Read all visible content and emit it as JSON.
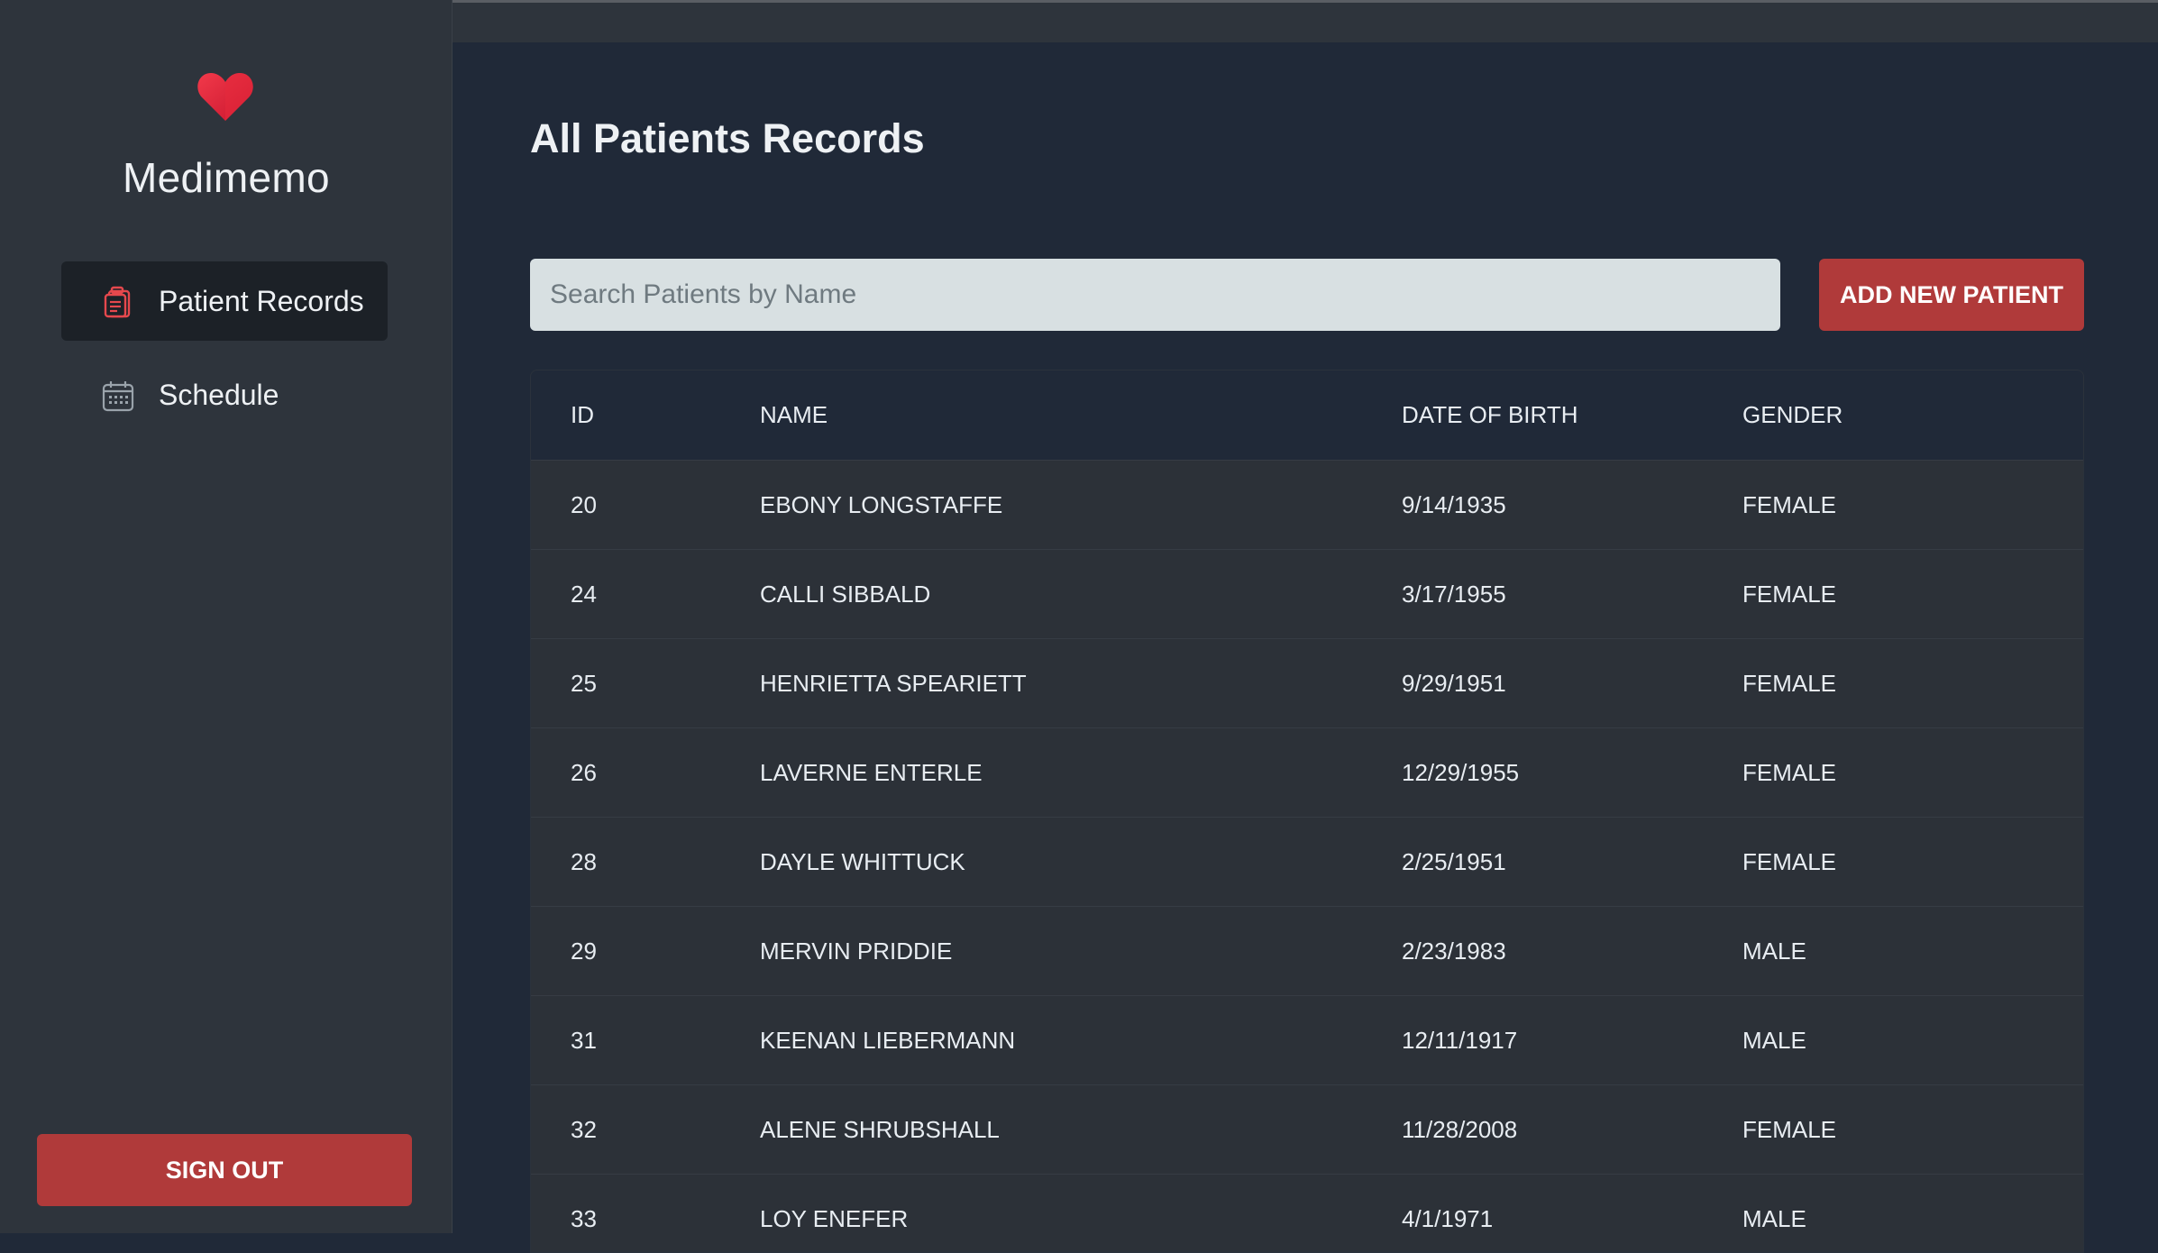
{
  "app": {
    "brand": "Medimemo",
    "accent_color": "#b03a3a",
    "icon_logo": "heart-icon"
  },
  "sidebar": {
    "items": [
      {
        "label": "Patient Records",
        "icon": "clipboard-icon",
        "active": true
      },
      {
        "label": "Schedule",
        "icon": "calendar-icon",
        "active": false
      }
    ],
    "sign_out_label": "SIGN OUT"
  },
  "main": {
    "title": "All Patients Records",
    "search": {
      "placeholder": "Search Patients by Name",
      "value": ""
    },
    "add_button_label": "ADD NEW PATIENT",
    "table": {
      "headers": {
        "id": "ID",
        "name": "NAME",
        "dob": "DATE OF BIRTH",
        "gender": "GENDER"
      },
      "rows": [
        {
          "id": "20",
          "name": "EBONY LONGSTAFFE",
          "dob": "9/14/1935",
          "gender": "FEMALE"
        },
        {
          "id": "24",
          "name": "CALLI SIBBALD",
          "dob": "3/17/1955",
          "gender": "FEMALE"
        },
        {
          "id": "25",
          "name": "HENRIETTA SPEARIETT",
          "dob": "9/29/1951",
          "gender": "FEMALE"
        },
        {
          "id": "26",
          "name": "LAVERNE ENTERLE",
          "dob": "12/29/1955",
          "gender": "FEMALE"
        },
        {
          "id": "28",
          "name": "DAYLE WHITTUCK",
          "dob": "2/25/1951",
          "gender": "FEMALE"
        },
        {
          "id": "29",
          "name": "MERVIN PRIDDIE",
          "dob": "2/23/1983",
          "gender": "MALE"
        },
        {
          "id": "31",
          "name": "KEENAN LIEBERMANN",
          "dob": "12/11/1917",
          "gender": "MALE"
        },
        {
          "id": "32",
          "name": "ALENE SHRUBSHALL",
          "dob": "11/28/2008",
          "gender": "FEMALE"
        },
        {
          "id": "33",
          "name": "LOY ENEFER",
          "dob": "4/1/1971",
          "gender": "MALE"
        }
      ]
    }
  }
}
